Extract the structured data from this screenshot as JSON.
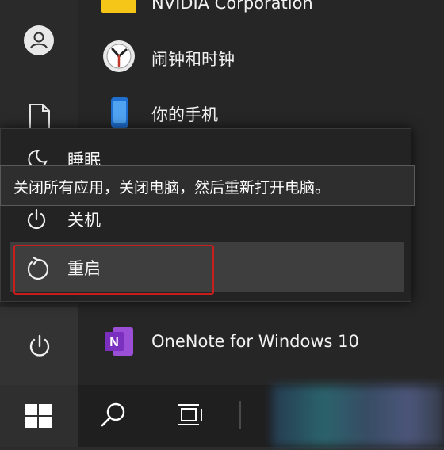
{
  "apps": [
    {
      "label": "NVIDIA Corporation",
      "icon": "folder-icon"
    },
    {
      "label": "闹钟和时钟",
      "icon": "clock-icon"
    },
    {
      "label": "你的手机",
      "icon": "phone-icon"
    },
    {
      "label": "OneNote for Windows 10",
      "icon": "onenote-icon"
    }
  ],
  "power_menu": {
    "tooltip": "关闭所有应用，关闭电脑，然后重新打开电脑。",
    "shutdown_label": "关机",
    "restart_label": "重启",
    "sleep_label_partial": "睡眠"
  },
  "colors": {
    "highlight_outline": "#c81e1e",
    "onenote_purple": "#7b2fbe",
    "folder_yellow": "#f5c518"
  }
}
